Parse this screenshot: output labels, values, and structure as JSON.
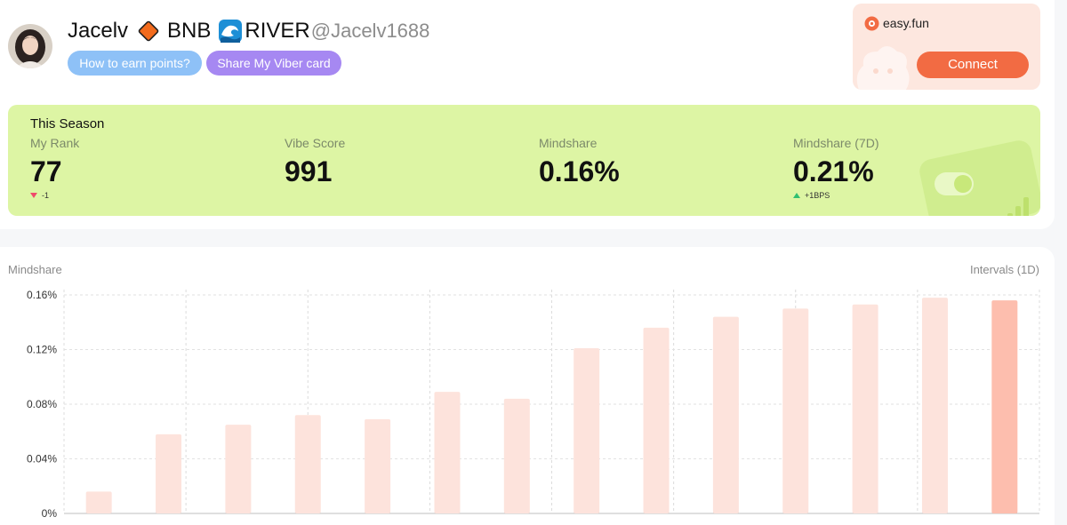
{
  "profile": {
    "name": "Jacelv",
    "bnb_label": "BNB",
    "river_label": "RIVER",
    "handle": "@Jacelv1688"
  },
  "buttons": {
    "earn_points": "How to earn points?",
    "share_card": "Share My Viber card"
  },
  "promo": {
    "name": "easy.fun",
    "connect": "Connect"
  },
  "season": {
    "title": "This Season",
    "stats": [
      {
        "label": "My Rank",
        "value": "77",
        "delta": "-1",
        "direction": "down"
      },
      {
        "label": "Vibe Score",
        "value": "991"
      },
      {
        "label": "Mindshare",
        "value": "0.16%"
      },
      {
        "label": "Mindshare (7D)",
        "value": "0.21%",
        "delta": "+1BPS",
        "direction": "up"
      }
    ]
  },
  "chart_header": {
    "title": "Mindshare",
    "interval": "Intervals (1D)"
  },
  "colors": {
    "accent": "#f26b43",
    "season_bg": "#ddf5a4",
    "bar": "#fde3dc",
    "bar_latest": "#fdbeae",
    "earn_pill": "#8ec1f7",
    "share_pill": "#a688f2"
  },
  "chart_data": {
    "type": "bar",
    "title": "Mindshare",
    "y_ticks": [
      "0.16%",
      "0.12%",
      "0.08%",
      "0.04%",
      "0%"
    ],
    "ylim": [
      0,
      0.16
    ],
    "values": [
      0.016,
      0.058,
      0.065,
      0.072,
      0.069,
      0.089,
      0.084,
      0.121,
      0.136,
      0.144,
      0.15,
      0.153,
      0.158,
      0.156
    ],
    "highlight_last": true,
    "grid": true
  }
}
